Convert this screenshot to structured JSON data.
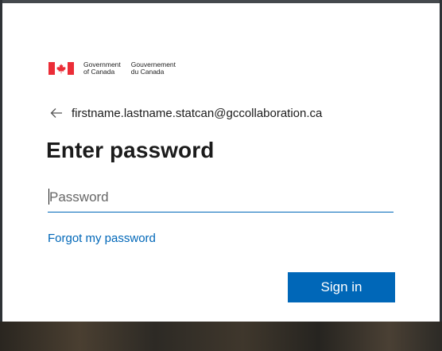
{
  "branding": {
    "en_line1": "Government",
    "en_line2": "of Canada",
    "fr_line1": "Gouvernement",
    "fr_line2": "du Canada",
    "flag_red": "#eb2d37",
    "icon": "canada-flag-icon"
  },
  "identity": {
    "back_icon": "back-arrow-icon",
    "email": "firstname.lastname.statcan@gccollaboration.ca"
  },
  "form": {
    "title": "Enter password",
    "password_placeholder": "Password",
    "password_value": "",
    "forgot_label": "Forgot my password",
    "sign_in_label": "Sign in"
  },
  "colors": {
    "accent": "#0067b8",
    "text": "#1b1b1b",
    "card": "#ffffff"
  }
}
